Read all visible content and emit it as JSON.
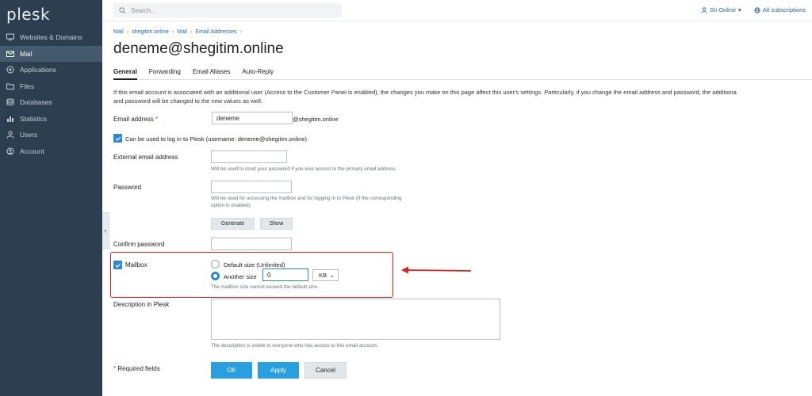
{
  "app": {
    "logo": "plesk"
  },
  "sidebar": {
    "items": [
      {
        "label": "Websites & Domains",
        "icon": "monitor-icon"
      },
      {
        "label": "Mail",
        "icon": "mail-icon",
        "active": true
      },
      {
        "label": "Applications",
        "icon": "applications-icon"
      },
      {
        "label": "Files",
        "icon": "folder-icon"
      },
      {
        "label": "Databases",
        "icon": "database-icon"
      },
      {
        "label": "Statistics",
        "icon": "statistics-icon"
      },
      {
        "label": "Users",
        "icon": "users-icon"
      },
      {
        "label": "Account",
        "icon": "account-icon"
      }
    ]
  },
  "topbar": {
    "search_placeholder": "Search...",
    "user": "Sh Online",
    "subscriptions": "All subscriptions"
  },
  "breadcrumb": [
    "Mail",
    "shegitim.online",
    "Mail",
    "Email Addresses"
  ],
  "page_title": "deneme@shegitim.online",
  "tabs": [
    "General",
    "Forwarding",
    "Email Aliases",
    "Auto-Reply"
  ],
  "intro": {
    "line1": "If this email account is associated with an additional user (Access to the Customer Panel is enabled), the changes you make on this page affect this user's settings. Particularly, if you change the email address and password, the additiona",
    "line2": "and password will be changed to the new values as well."
  },
  "form": {
    "email_label": "Email address",
    "required_mark": "*",
    "email_value": "deneme",
    "email_domain": "@shegitim.online",
    "login_checkbox_label": "Can be used to log in to Plesk  (username: deneme@shegitim.online)",
    "external_label": "External email address",
    "external_hint": "Will be used to reset your password if you lose access to the primary email address.",
    "password_label": "Password",
    "password_hint_1": "Will be used for accessing the mailbox and for logging in to Plesk (if the corresponding",
    "password_hint_2": "option is enabled).",
    "generate_button": "Generate",
    "show_button": "Show",
    "confirm_label": "Confirm password",
    "mailbox_label": "Mailbox",
    "default_size_label": "Default size (Unlimited)",
    "another_size_label": "Another size",
    "size_value": "0",
    "size_unit": "KB",
    "mailbox_hint": "The mailbox size cannot exceed the default size.",
    "description_label": "Description in Plesk",
    "description_hint": "The description is visible to everyone who has access to this email account.",
    "required_fields": "Required fields"
  },
  "buttons": {
    "ok": "OK",
    "apply": "Apply",
    "cancel": "Cancel"
  },
  "colors": {
    "sidebar": "#2c3e50",
    "accent": "#28a0e0",
    "highlight": "#e01f1f"
  }
}
